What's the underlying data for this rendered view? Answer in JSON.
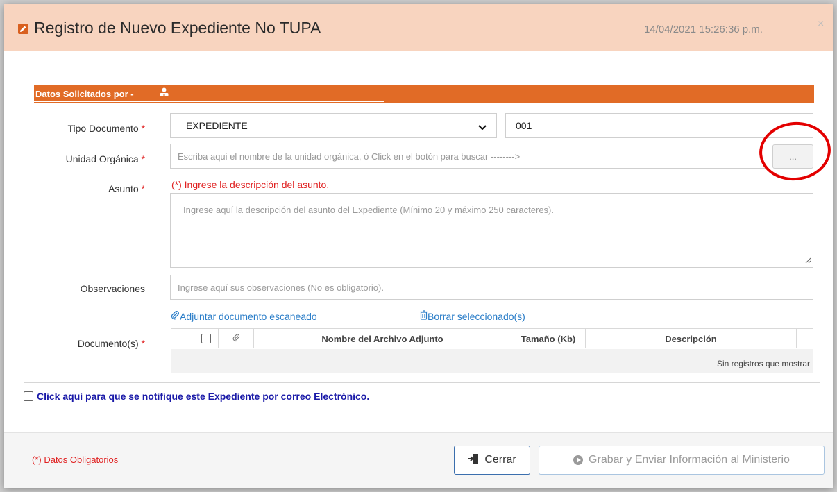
{
  "header": {
    "title": "Registro de Nuevo Expediente No TUPA",
    "datetime": "14/04/2021 15:26:36 p.m.",
    "close_label": "×"
  },
  "section": {
    "label": "Datos Solicitados por -"
  },
  "form": {
    "tipo_documento": {
      "label": "Tipo Documento",
      "required_mark": "*",
      "value": "EXPEDIENTE",
      "number": "001"
    },
    "unidad_organica": {
      "label": "Unidad Orgánica",
      "required_mark": "*",
      "placeholder": "Escriba aqui el nombre de la unidad orgánica, ó Click en el botón para buscar -------->",
      "button_label": "..."
    },
    "asunto": {
      "label": "Asunto",
      "required_mark": "*",
      "hint": "(*) Ingrese la descripción del asunto.",
      "placeholder": "Ingrese aquí la descripción del asunto del Expediente (Mínimo 20 y máximo 250 caracteres)."
    },
    "observaciones": {
      "label": "Observaciones",
      "placeholder": "Ingrese aquí sus observaciones (No es obligatorio)."
    },
    "links": {
      "attach": "Adjuntar documento escaneado",
      "delete": "Borrar seleccionado(s)"
    },
    "documentos": {
      "label": "Documento(s)",
      "required_mark": "*",
      "columns": [
        "Nombre del Archivo Adjunto",
        "Tamaño (Kb)",
        "Descripción"
      ],
      "empty_message": "Sin registros que mostrar"
    }
  },
  "notify_label": "Click aquí para que se notifique este Expediente por correo Electrónico.",
  "footer": {
    "required_note": "(*) Datos Obligatorios",
    "close_button": "Cerrar",
    "send_button": "Grabar y Enviar Información al Ministerio"
  },
  "colors": {
    "accent": "#e16b26",
    "header_bg": "#f8d4bf",
    "required": "#e02020",
    "link": "#2a7dc8",
    "annotation": "#e30000"
  }
}
